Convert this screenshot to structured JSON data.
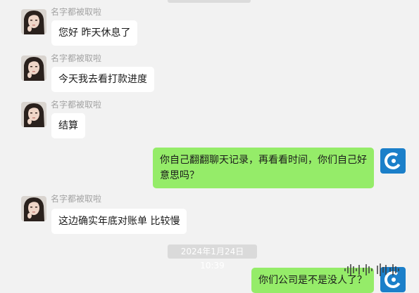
{
  "contact": {
    "name": "名字都被取啦"
  },
  "messages": [
    {
      "sender": "名字都被取啦",
      "text": "您好 昨天休息了"
    },
    {
      "sender": "名字都被取啦",
      "text": "今天我去看打款进度"
    },
    {
      "sender": "名字都被取啦",
      "text": "结算"
    },
    {
      "sender": "me",
      "text": "你自己翻翻聊天记录，再看看时间，你们自己好意思吗？"
    },
    {
      "sender": "名字都被取啦",
      "text": "这边确实年底对账单 比较慢"
    },
    {
      "sender": "me",
      "text": "你们公司是不是没人了？"
    }
  ],
  "timestamp": "2024年1月24日 10:39",
  "icons": {
    "contact_avatar": "girl-photo-avatar",
    "my_avatar": "blue-c-logo-avatar",
    "toolbar": "volume-bars-icon"
  },
  "colors": {
    "background": "#f2f2f2",
    "incoming_bubble": "#ffffff",
    "outgoing_bubble": "#95ec69",
    "my_avatar_bg": "#1b7fc9"
  }
}
